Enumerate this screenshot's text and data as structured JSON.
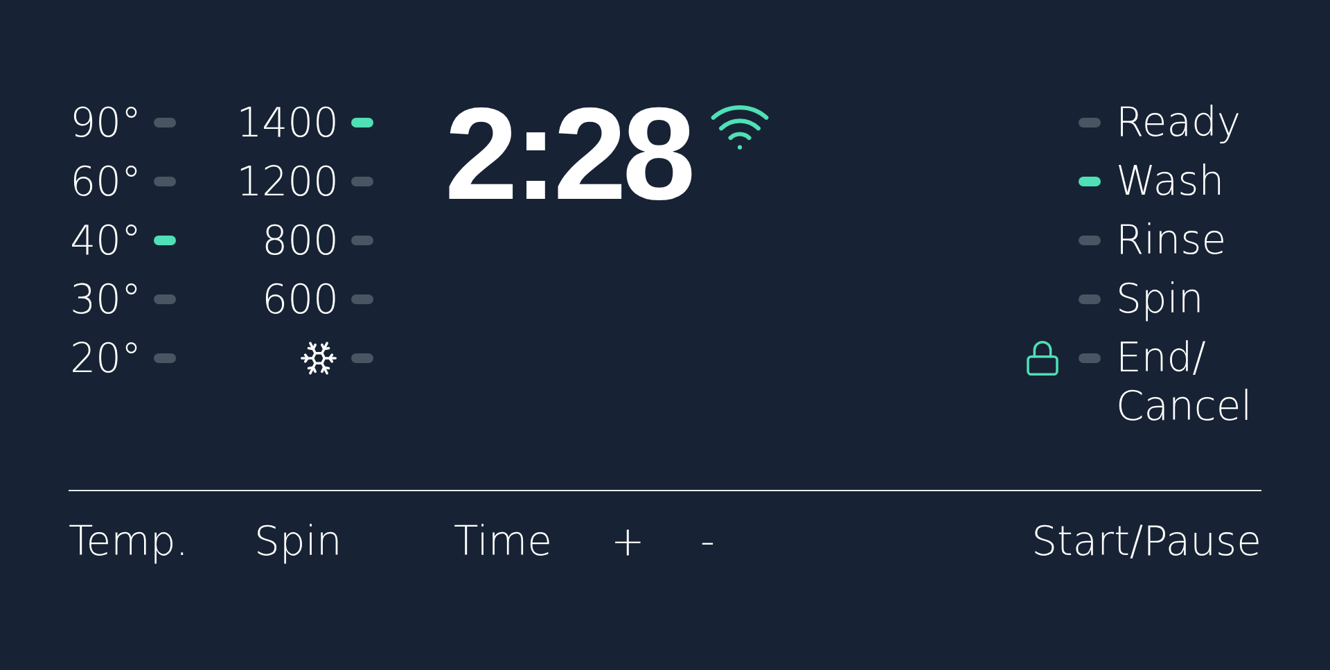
{
  "temperatures": [
    {
      "label": "90°",
      "selected": false
    },
    {
      "label": "60°",
      "selected": false
    },
    {
      "label": "40°",
      "selected": true
    },
    {
      "label": "30°",
      "selected": false
    },
    {
      "label": "20°",
      "selected": false
    }
  ],
  "spin_speeds": [
    {
      "kind": "text",
      "label": "1400",
      "selected": true
    },
    {
      "kind": "text",
      "label": "1200",
      "selected": false
    },
    {
      "kind": "text",
      "label": "800",
      "selected": false
    },
    {
      "kind": "text",
      "label": "600",
      "selected": false
    },
    {
      "kind": "cold",
      "selected": false
    }
  ],
  "time": {
    "value": "2:28"
  },
  "status_steps": [
    {
      "label": "Ready",
      "selected": false,
      "locked": false
    },
    {
      "label": "Wash",
      "selected": true,
      "locked": false
    },
    {
      "label": "Rinse",
      "selected": false,
      "locked": false
    },
    {
      "label": "Spin",
      "selected": false,
      "locked": false
    },
    {
      "label": "End/\nCancel",
      "selected": false,
      "locked": true
    }
  ],
  "buttons": [
    {
      "label": "Temp."
    },
    {
      "label": "Spin"
    },
    {
      "label": "Time"
    },
    {
      "label": "+"
    },
    {
      "label": "-"
    },
    {
      "label": "Start/Pause"
    }
  ]
}
